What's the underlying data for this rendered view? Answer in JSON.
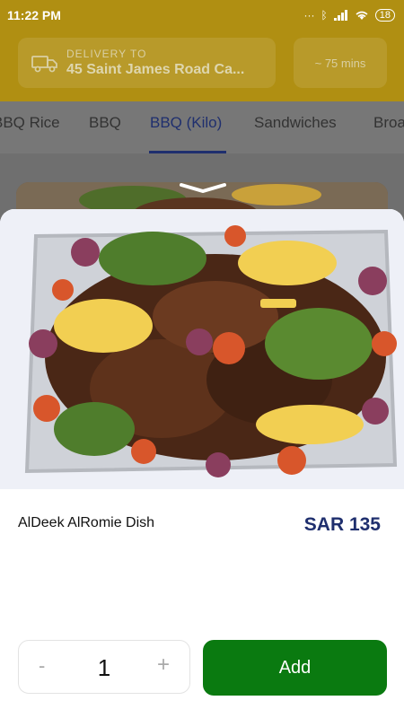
{
  "status_bar": {
    "time": "11:22 PM",
    "battery": "18",
    "icons": [
      "dots-icon",
      "bluetooth-icon",
      "signal-icon",
      "wifi-icon",
      "battery-icon"
    ]
  },
  "header": {
    "delivery_label": "DELIVERY TO",
    "delivery_address": "45 Saint James Road Ca...",
    "delivery_time": "~ 75 mins"
  },
  "tabs": [
    {
      "label": "BBQ Rice",
      "active": false
    },
    {
      "label": "BBQ",
      "active": false
    },
    {
      "label": "BBQ (Kilo)",
      "active": true
    },
    {
      "label": "Sandwiches",
      "active": false
    },
    {
      "label": "Broa",
      "active": false
    }
  ],
  "item": {
    "name": "AlDeek AlRomie Dish",
    "price": "SAR 135",
    "image": "grilled-chicken-platter-image"
  },
  "quantity": {
    "minus_label": "-",
    "value": "1",
    "plus_label": "+"
  },
  "actions": {
    "add_label": "Add"
  },
  "colors": {
    "header": "#b08f12",
    "accent": "#1f2f6e",
    "add_button": "#0a7a10"
  }
}
